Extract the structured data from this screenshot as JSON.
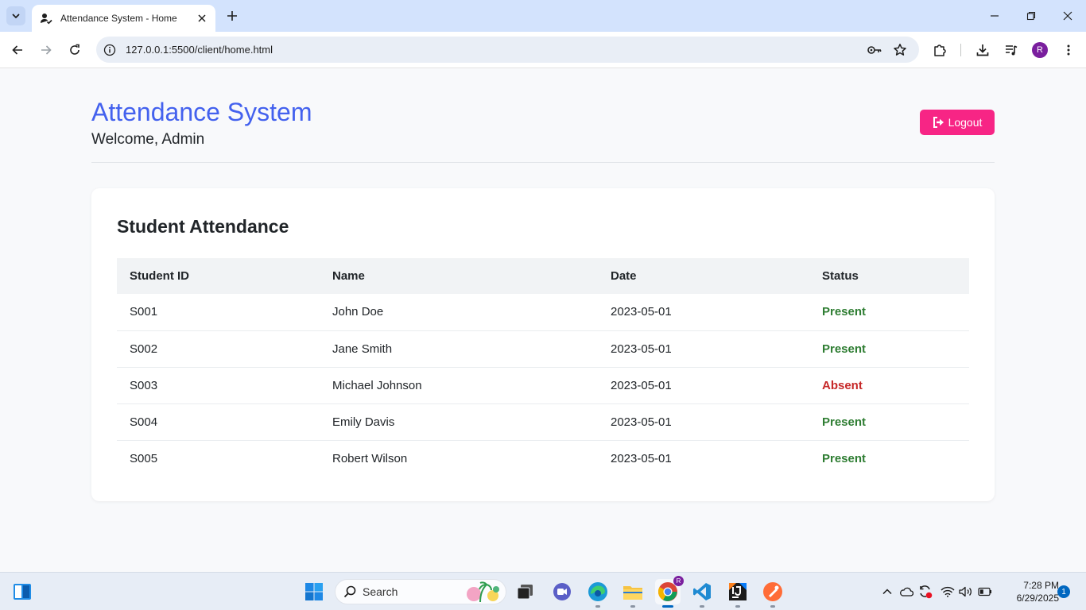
{
  "browser": {
    "tab_title": "Attendance System - Home",
    "url": "127.0.0.1:5500/client/home.html",
    "profile_initial": "R"
  },
  "header": {
    "title": "Attendance System",
    "welcome": "Welcome, Admin",
    "logout_label": "Logout"
  },
  "attendance": {
    "title": "Student Attendance",
    "columns": [
      "Student ID",
      "Name",
      "Date",
      "Status"
    ],
    "rows": [
      {
        "id": "S001",
        "name": "John Doe",
        "date": "2023-05-01",
        "status": "Present"
      },
      {
        "id": "S002",
        "name": "Jane Smith",
        "date": "2023-05-01",
        "status": "Present"
      },
      {
        "id": "S003",
        "name": "Michael Johnson",
        "date": "2023-05-01",
        "status": "Absent"
      },
      {
        "id": "S004",
        "name": "Emily Davis",
        "date": "2023-05-01",
        "status": "Present"
      },
      {
        "id": "S005",
        "name": "Robert Wilson",
        "date": "2023-05-01",
        "status": "Present"
      }
    ]
  },
  "taskbar": {
    "search_label": "Search",
    "time": "7:28 PM",
    "date": "6/29/2025",
    "notification_count": "1",
    "chrome_badge": "R"
  },
  "colors": {
    "accent": "#4361ee",
    "logout": "#f72585",
    "present": "#2e7d32",
    "absent": "#c62828"
  }
}
